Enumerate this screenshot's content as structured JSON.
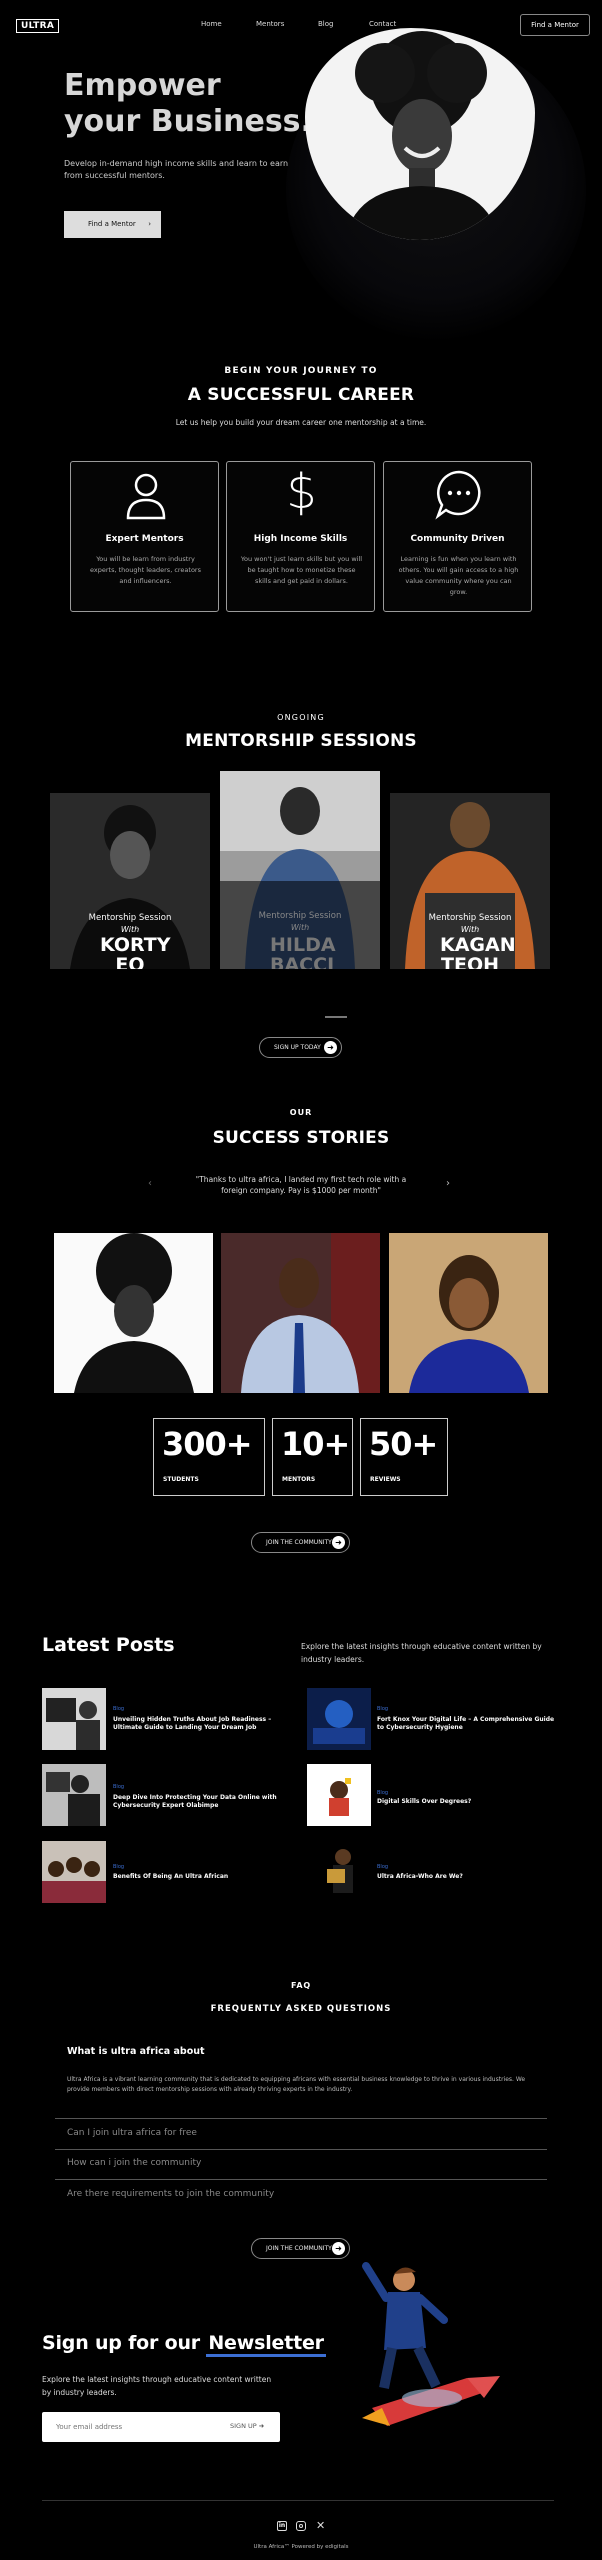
{
  "nav": {
    "logo": "ULTRA",
    "links": [
      "Home",
      "Mentors",
      "Blog",
      "Contact"
    ],
    "cta": "Find a Mentor"
  },
  "hero": {
    "title_line1": "Empower",
    "title_line2": "your Business.",
    "subtitle": "Develop in-demand high income skills and learn to earn from successful mentors.",
    "button": "Find a Mentor"
  },
  "journey": {
    "eyebrow": "BEGIN YOUR JOURNEY TO",
    "title": "A SUCCESSFUL CAREER",
    "subtitle": "Let us help you build your dream career one mentorship at a time.",
    "cards": [
      {
        "icon": "user-icon",
        "title": "Expert Mentors",
        "desc": "You will be learn from industry experts, thought leaders, creators and influencers."
      },
      {
        "icon": "dollar-icon",
        "title": "High Income Skills",
        "desc": "You won't just learn skills but you will be taught how to monetize these skills and get paid in dollars."
      },
      {
        "icon": "chat-bubble-icon",
        "title": "Community Driven",
        "desc": "Learning is fun when you learn with others. You will gain access to a high value community where you can grow."
      }
    ]
  },
  "sessions": {
    "eyebrow": "ONGOING",
    "title": "MENTORSHIP SESSIONS",
    "items": [
      {
        "label": "Mentorship Session",
        "with": "With",
        "name": "KORTY EO"
      },
      {
        "label": "Mentorship Session",
        "with": "With",
        "name": "HILDA BACCI"
      },
      {
        "label": "Mentorship Session",
        "with": "With",
        "name": "KAGAN TEOH"
      }
    ],
    "button": "SIGN UP TODAY"
  },
  "stories": {
    "eyebrow": "OUR",
    "title": "SUCCESS STORIES",
    "quote": "\"Thanks to ultra africa, I landed my first tech role with a foreign company. Pay is $1000 per month\"",
    "stats": [
      {
        "num": "300+",
        "label": "STUDENTS"
      },
      {
        "num": "10+",
        "label": "MENTORS"
      },
      {
        "num": "50+",
        "label": "REVIEWS"
      }
    ],
    "button": "JOIN THE COMMUNITY"
  },
  "posts": {
    "title": "Latest Posts",
    "intro": "Explore the latest insights through educative content written by industry leaders.",
    "items": [
      {
        "cat": "Blog",
        "title": "Unveiling Hidden Truths About Job Readiness – Ultimate Guide to Landing Your Dream Job"
      },
      {
        "cat": "Blog",
        "title": "Fort Knox Your Digital Life – A Comprehensive Guide to Cybersecurity Hygiene"
      },
      {
        "cat": "Blog",
        "title": "Deep Dive Into Protecting Your Data Online with Cybersecurity Expert Olabimpe"
      },
      {
        "cat": "Blog",
        "title": "Digital Skills Over Degrees?"
      },
      {
        "cat": "Blog",
        "title": "Benefits Of Being An Ultra African"
      },
      {
        "cat": "Blog",
        "title": "Ultra Africa-Who Are We?"
      }
    ]
  },
  "faq": {
    "eyebrow": "FAQ",
    "title": "FREQUENTLY ASKED QUESTIONS",
    "open_q": "What is ultra africa about",
    "open_a": "Ultra Africa is a vibrant learning community that is dedicated to equipping africans with essential business knowledge to thrive in various industries. We provide members with direct mentorship sessions with already thriving experts in the industry.",
    "questions": [
      "Can I join ultra africa for free",
      "How can i join the community",
      "Are there requirements to join the community"
    ],
    "button": "JOIN THE COMMUNITY"
  },
  "newsletter": {
    "title_a": "Sign up for our",
    "title_b": "Newsletter",
    "desc": "Explore the latest insights through educative content written by industry leaders.",
    "placeholder": "Your email address",
    "button": "SIGN UP"
  },
  "footer": {
    "credit": "Ultra Africa™ Powered by edigitals"
  },
  "colors": {
    "accent_blue": "#3c6fd4",
    "background": "#000000"
  }
}
